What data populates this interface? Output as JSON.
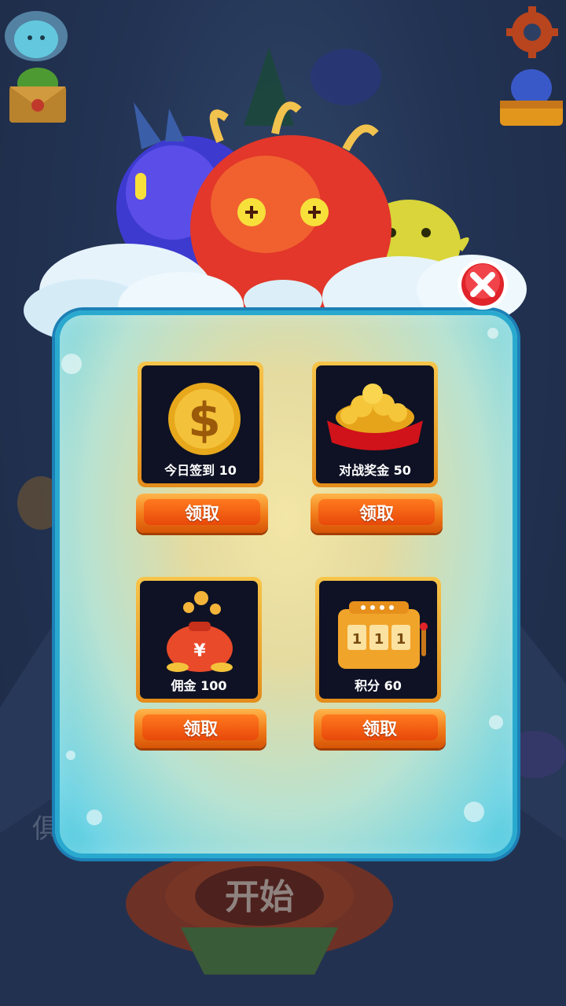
{
  "background": {
    "start_label": "开始",
    "club_label": "俱乐部"
  },
  "header": {
    "avatar_icon": "slime-avatar-icon",
    "mail_icon": "mail-envelope-icon",
    "settings_icon": "gear-icon",
    "shop_icon": "slime-shop-icon"
  },
  "dialog": {
    "close_icon": "close-x-icon",
    "rewards": [
      {
        "label": "今日签到 10",
        "icon": "dollar-coin-icon",
        "button": "领取"
      },
      {
        "label": "对战奖金 50",
        "icon": "gold-coin-pile-icon",
        "button": "领取"
      },
      {
        "label": "佣金 100",
        "icon": "money-bag-icon",
        "button": "领取"
      },
      {
        "label": "积分 60",
        "icon": "slot-machine-icon",
        "button": "领取"
      }
    ]
  },
  "colors": {
    "panel_border": "#2aa9cf",
    "button_orange": "#f07a18",
    "tile_frame": "#f7c54a",
    "close_red": "#e0242a"
  }
}
